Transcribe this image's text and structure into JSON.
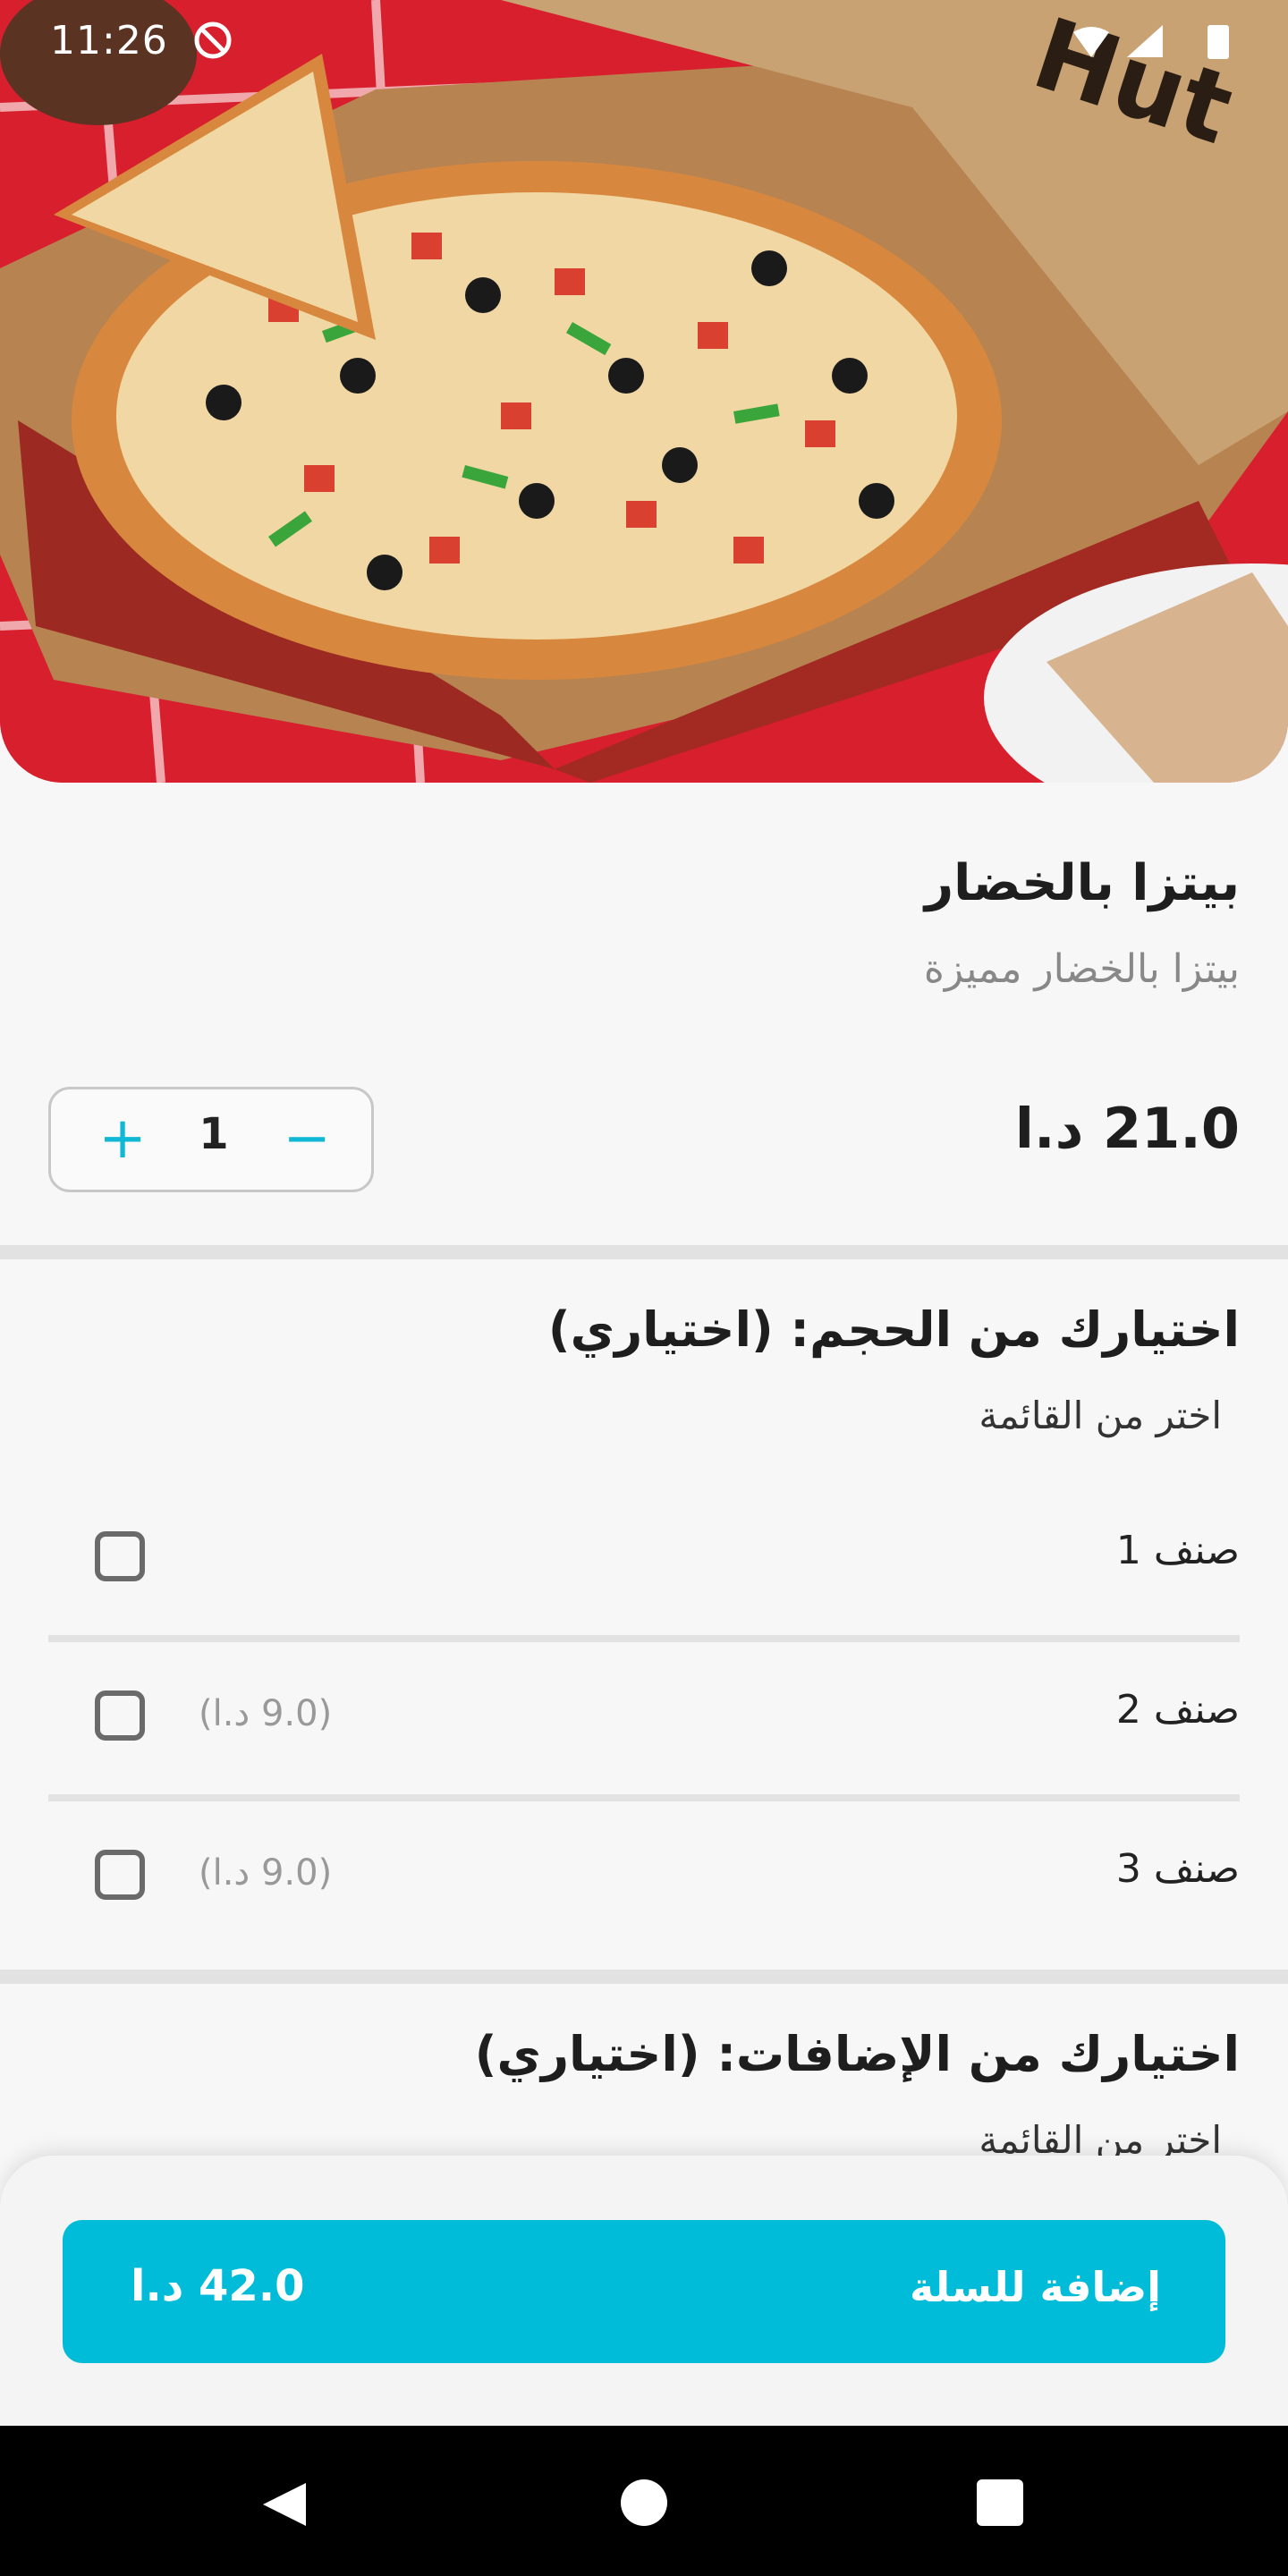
{
  "status_bar": {
    "time": "11:26"
  },
  "hero": {
    "image": "pizza-hut-vegetable-pizza-photo"
  },
  "product": {
    "title": "بيتزا بالخضار",
    "description": "بيتزا بالخضار مميزة",
    "price": "21.0 د.ا",
    "quantity": "1"
  },
  "size_section": {
    "title": "اختيارك من الحجم: (اختياري)",
    "subtitle": "اختر من القائمة",
    "options": [
      {
        "label": "صنف 1",
        "price": ""
      },
      {
        "label": "صنف 2",
        "price": "(9.0 د.ا)"
      },
      {
        "label": "صنف 3",
        "price": "(9.0 د.ا)"
      }
    ]
  },
  "addons_section": {
    "title": "اختيارك من الإضافات: (اختياري)",
    "subtitle": "اختر من القائمة"
  },
  "cart": {
    "label": "إضافة للسلة",
    "total": "42.0 د.ا"
  },
  "colors": {
    "accent": "#00bcd8",
    "brand_red": "#c8182a"
  }
}
